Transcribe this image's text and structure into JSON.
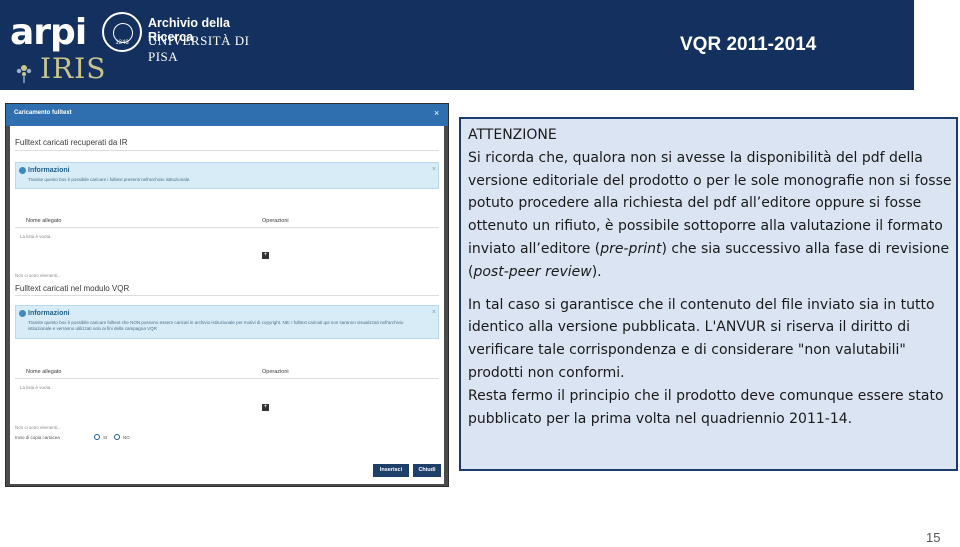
{
  "header": {
    "logo_arpi": "arpi",
    "archivio": "Archivio della Ricerca",
    "universita": "UNIVERSITÀ DI PISA",
    "seal_year": "1343",
    "logo_iris": "IRIS",
    "title": "VQR 2011-2014"
  },
  "screenshot": {
    "modal_title": "Caricamento fulltext",
    "section1_title": "Fulltext caricati recuperati da IR",
    "info1_title": "Informazioni",
    "info1_text": "Tramite questo box è possibile caricare i fulltext presenti nell'archivio istituzionale.",
    "col_name": "Nome allegato",
    "col_ops": "Operazioni",
    "empty_list_1": "La lista è vuota.",
    "no_elements_1": "Non ci sono elementi...",
    "section2_title": "Fulltext caricati nel modulo VQR",
    "info2_title": "Informazioni",
    "info2_text": "Tramite questo box è possibile caricare fulltext che NON possono essere caricati in archivio istituzionale per motivi di copyright. NB: I fulltext caricati qui non saranno visualizzati nell'archivio istituzionale e verranno utilizzati solo ai fini della campagna VQR",
    "col_name_2": "Nome allegato",
    "col_ops_2": "Operazioni",
    "empty_list_2": "La lista è vuota.",
    "no_elements_2": "Non ci sono elementi...",
    "paper_copy_label": "Invio di copia cartacea",
    "radio_yes": "SI",
    "radio_no": "NO",
    "btn_insert": "Inserisci",
    "btn_close": "Chiudi"
  },
  "notice": {
    "heading": "ATTENZIONE",
    "p1_before": "Si ricorda che, qualora non si avesse la disponibilità del pdf della versione editoriale del prodotto o per le sole monografie non si fosse potuto procedere alla richiesta del pdf all’editore oppure si fosse ottenuto un rifiuto, è possibile sottoporre alla valutazione il formato inviato all’editore (",
    "p1_preprint": "pre-print",
    "p1_middle": ") che sia successivo alla fase di revisione (",
    "p1_postpeer": "post-peer review",
    "p1_end": ").",
    "p2": "In tal caso si garantisce che il contenuto del file inviato sia in tutto identico alla versione pubblicata. L'ANVUR si riserva il diritto di verificare tale corrispondenza e di considerare \"non valutabili\" prodotti non conformi.",
    "p3": "Resta fermo il principio che il prodotto deve comunque essere stato pubblicato per la prima volta nel quadriennio 2011-14."
  },
  "page_number": "15",
  "colors": {
    "header_bg": "#14305e",
    "box_bg": "#dbe4f2",
    "box_border": "#1b3b6f",
    "modal_head": "#2f6fb0"
  }
}
